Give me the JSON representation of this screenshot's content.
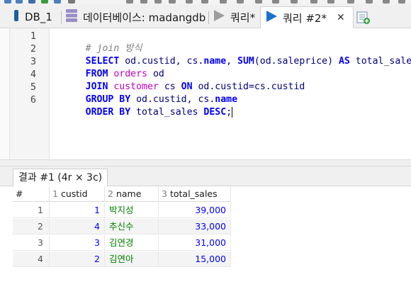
{
  "tabs": [
    {
      "label": "DB_1",
      "icon": "dolphin-icon"
    },
    {
      "label": "데이터베이스: madangdb",
      "icon": "database-icon"
    },
    {
      "label": "쿼리*",
      "icon": "play-icon"
    },
    {
      "label": "쿼리 #2*",
      "icon": "play-icon",
      "close": "✕"
    }
  ],
  "editor": {
    "line_numbers": [
      "1",
      "2",
      "3",
      "4",
      "5",
      "6"
    ],
    "lines": [
      [
        {
          "t": "# join 방식",
          "c": "cm"
        }
      ],
      [
        {
          "t": "SELECT",
          "c": "kw"
        },
        {
          "t": " od.custid, cs.",
          "c": "pl"
        },
        {
          "t": "name",
          "c": "kw"
        },
        {
          "t": ", ",
          "c": "pl"
        },
        {
          "t": "SUM",
          "c": "fn"
        },
        {
          "t": "(od.saleprice) ",
          "c": "pl"
        },
        {
          "t": "AS",
          "c": "kw"
        },
        {
          "t": " total_sales",
          "c": "pl"
        }
      ],
      [
        {
          "t": "FROM",
          "c": "kw"
        },
        {
          "t": " ",
          "c": "pl"
        },
        {
          "t": "orders",
          "c": "tb"
        },
        {
          "t": " od",
          "c": "pl"
        }
      ],
      [
        {
          "t": "JOIN",
          "c": "kw"
        },
        {
          "t": " ",
          "c": "pl"
        },
        {
          "t": "customer",
          "c": "tb"
        },
        {
          "t": " cs ",
          "c": "pl"
        },
        {
          "t": "ON",
          "c": "kw"
        },
        {
          "t": " od.custid=cs.custid",
          "c": "pl"
        }
      ],
      [
        {
          "t": "GROUP BY",
          "c": "kw"
        },
        {
          "t": " od.custid, cs.",
          "c": "pl"
        },
        {
          "t": "name",
          "c": "kw"
        }
      ],
      [
        {
          "t": "ORDER BY",
          "c": "kw"
        },
        {
          "t": " total_sales ",
          "c": "pl"
        },
        {
          "t": "DESC",
          "c": "kw"
        },
        {
          "t": ";",
          "c": "pl"
        }
      ]
    ]
  },
  "result": {
    "tab_label": "결과 #1 (4r × 3c)",
    "columns": [
      {
        "num": "#",
        "name": ""
      },
      {
        "num": "1",
        "name": "custid"
      },
      {
        "num": "2",
        "name": "name"
      },
      {
        "num": "3",
        "name": "total_sales"
      }
    ],
    "rows": [
      {
        "n": "1",
        "custid": "1",
        "name": "박지성",
        "total_sales": "39,000"
      },
      {
        "n": "2",
        "custid": "4",
        "name": "추신수",
        "total_sales": "33,000"
      },
      {
        "n": "3",
        "custid": "3",
        "name": "김연경",
        "total_sales": "31,000"
      },
      {
        "n": "4",
        "custid": "2",
        "name": "김연아",
        "total_sales": "15,000"
      }
    ]
  },
  "colors": {
    "keyword": "#0000ff",
    "table": "#c000c0",
    "comment": "#808080",
    "number": "#0000ff",
    "text": "#008000"
  }
}
